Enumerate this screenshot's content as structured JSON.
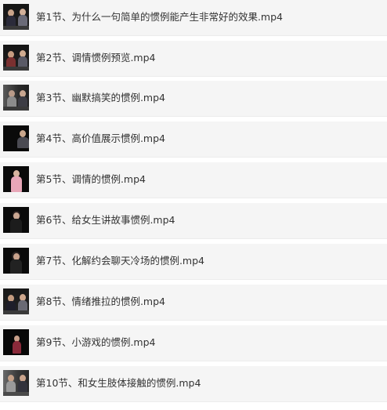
{
  "files": [
    {
      "name": "第1节、为什么一句简单的惯例能产生非常好的效果.mp4",
      "thumbnail": "two-people-talking-thumbnail"
    },
    {
      "name": "第2节、调情惯例预览.mp4",
      "thumbnail": "two-people-talking-thumbnail"
    },
    {
      "name": "第3节、幽默搞笑的惯例.mp4",
      "thumbnail": "two-people-talking-thumbnail"
    },
    {
      "name": "第4节、高价值展示惯例.mp4",
      "thumbnail": "speaker-thumbnail"
    },
    {
      "name": "第5节、调情的惯例.mp4",
      "thumbnail": "woman-speaker-thumbnail"
    },
    {
      "name": "第6节、给女生讲故事惯例.mp4",
      "thumbnail": "woman-speaker-thumbnail"
    },
    {
      "name": "第7节、化解约会聊天冷场的惯例.mp4",
      "thumbnail": "woman-speaker-thumbnail"
    },
    {
      "name": "第8节、情绪推拉的惯例.mp4",
      "thumbnail": "two-people-talking-thumbnail"
    },
    {
      "name": "第9节、小游戏的惯例.mp4",
      "thumbnail": "woman-speaker-thumbnail"
    },
    {
      "name": "第10节、和女生肢体接触的惯例.mp4",
      "thumbnail": "two-people-talking-thumbnail"
    }
  ]
}
